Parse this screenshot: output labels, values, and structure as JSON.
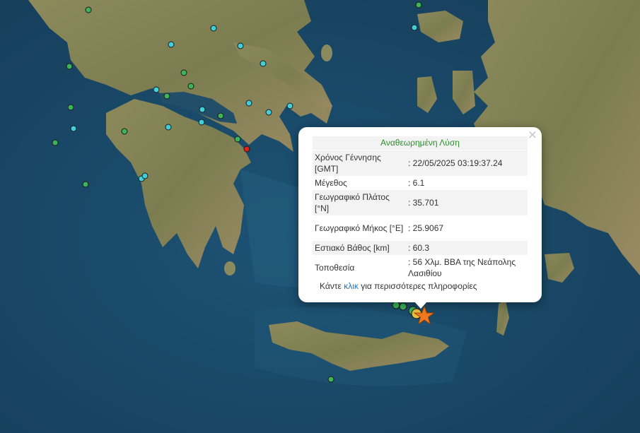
{
  "popup": {
    "title": "Αναθεωρημένη Λύση",
    "close_glyph": "×",
    "rows": [
      {
        "key": "Χρόνος Γέννησης [GMT]",
        "value": ": 22/05/2025 03:19:37.24"
      },
      {
        "key": "Μέγεθος",
        "value": ": 6.1"
      },
      {
        "key": "Γεωγραφικό Πλάτος [°N]",
        "value": ": 35.701"
      },
      {
        "key": "Γεωγραφικό Μήκος [°E]",
        "value": ": 25.9067"
      },
      {
        "key": "Εστιακό Βάθος [km]",
        "value": ": 60.3"
      },
      {
        "key": "Τοποθεσία",
        "value": ": 56 Χλμ. ΒΒΑ της Νεάπολης Λασιθίου"
      }
    ],
    "more_prefix": "Κάντε ",
    "more_link": "κλικ",
    "more_suffix": " για περισσότερες πληροφορίες"
  },
  "colors": {
    "sea": "#1c4e70",
    "land": "#8a8a5e",
    "marker_cyan": "#3fd0dc",
    "marker_green": "#3cb45a",
    "marker_red": "#e02020",
    "marker_yellow": "#e8c040",
    "epicenter_star": "#f0781e"
  },
  "markers": {
    "epicenter": "star",
    "types": [
      "cyan",
      "green",
      "red",
      "yellow"
    ]
  }
}
